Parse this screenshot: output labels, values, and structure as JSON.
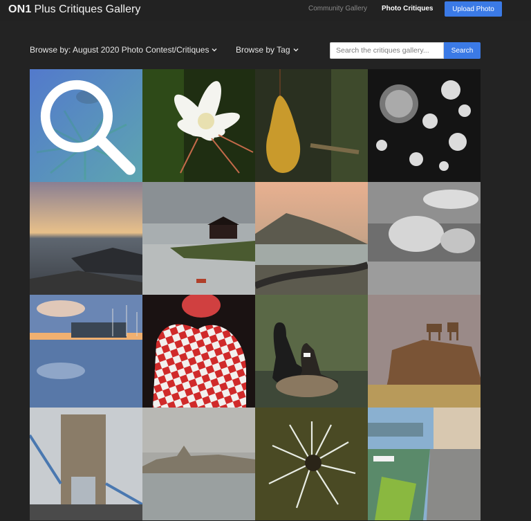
{
  "header": {
    "brand_bold": "ON1",
    "brand_rest": "Plus Critiques Gallery",
    "nav": [
      {
        "label": "Community Gallery",
        "active": false
      },
      {
        "label": "Photo Critiques",
        "active": true
      }
    ],
    "upload_label": "Upload Photo"
  },
  "filters": {
    "browse_by_label": "Browse by: August 2020 Photo Contest/Critiques",
    "browse_tag_label": "Browse by Tag"
  },
  "search": {
    "placeholder": "Search the critiques gallery...",
    "value": "",
    "button_label": "Search"
  },
  "colors": {
    "accent": "#3b7ae6",
    "background": "#232323"
  },
  "gallery": {
    "hover_icon": "search-icon",
    "items": [
      {
        "subject": "bee-on-flower",
        "hovered": true
      },
      {
        "subject": "white-cactus-flower"
      },
      {
        "subject": "hanging-pear"
      },
      {
        "subject": "bw-water-drops"
      },
      {
        "subject": "sunset-rocky-shore"
      },
      {
        "subject": "red-house-on-island"
      },
      {
        "subject": "misty-mountain-road"
      },
      {
        "subject": "bw-tree-landscape"
      },
      {
        "subject": "harbor-reflection"
      },
      {
        "subject": "checkered-body-paint"
      },
      {
        "subject": "canada-geese"
      },
      {
        "subject": "bighorn-sheep-on-rock"
      },
      {
        "subject": "tower-bridge"
      },
      {
        "subject": "foggy-castle"
      },
      {
        "subject": "dandelion-seed-head"
      },
      {
        "subject": "lakeside-village-canal"
      }
    ]
  }
}
